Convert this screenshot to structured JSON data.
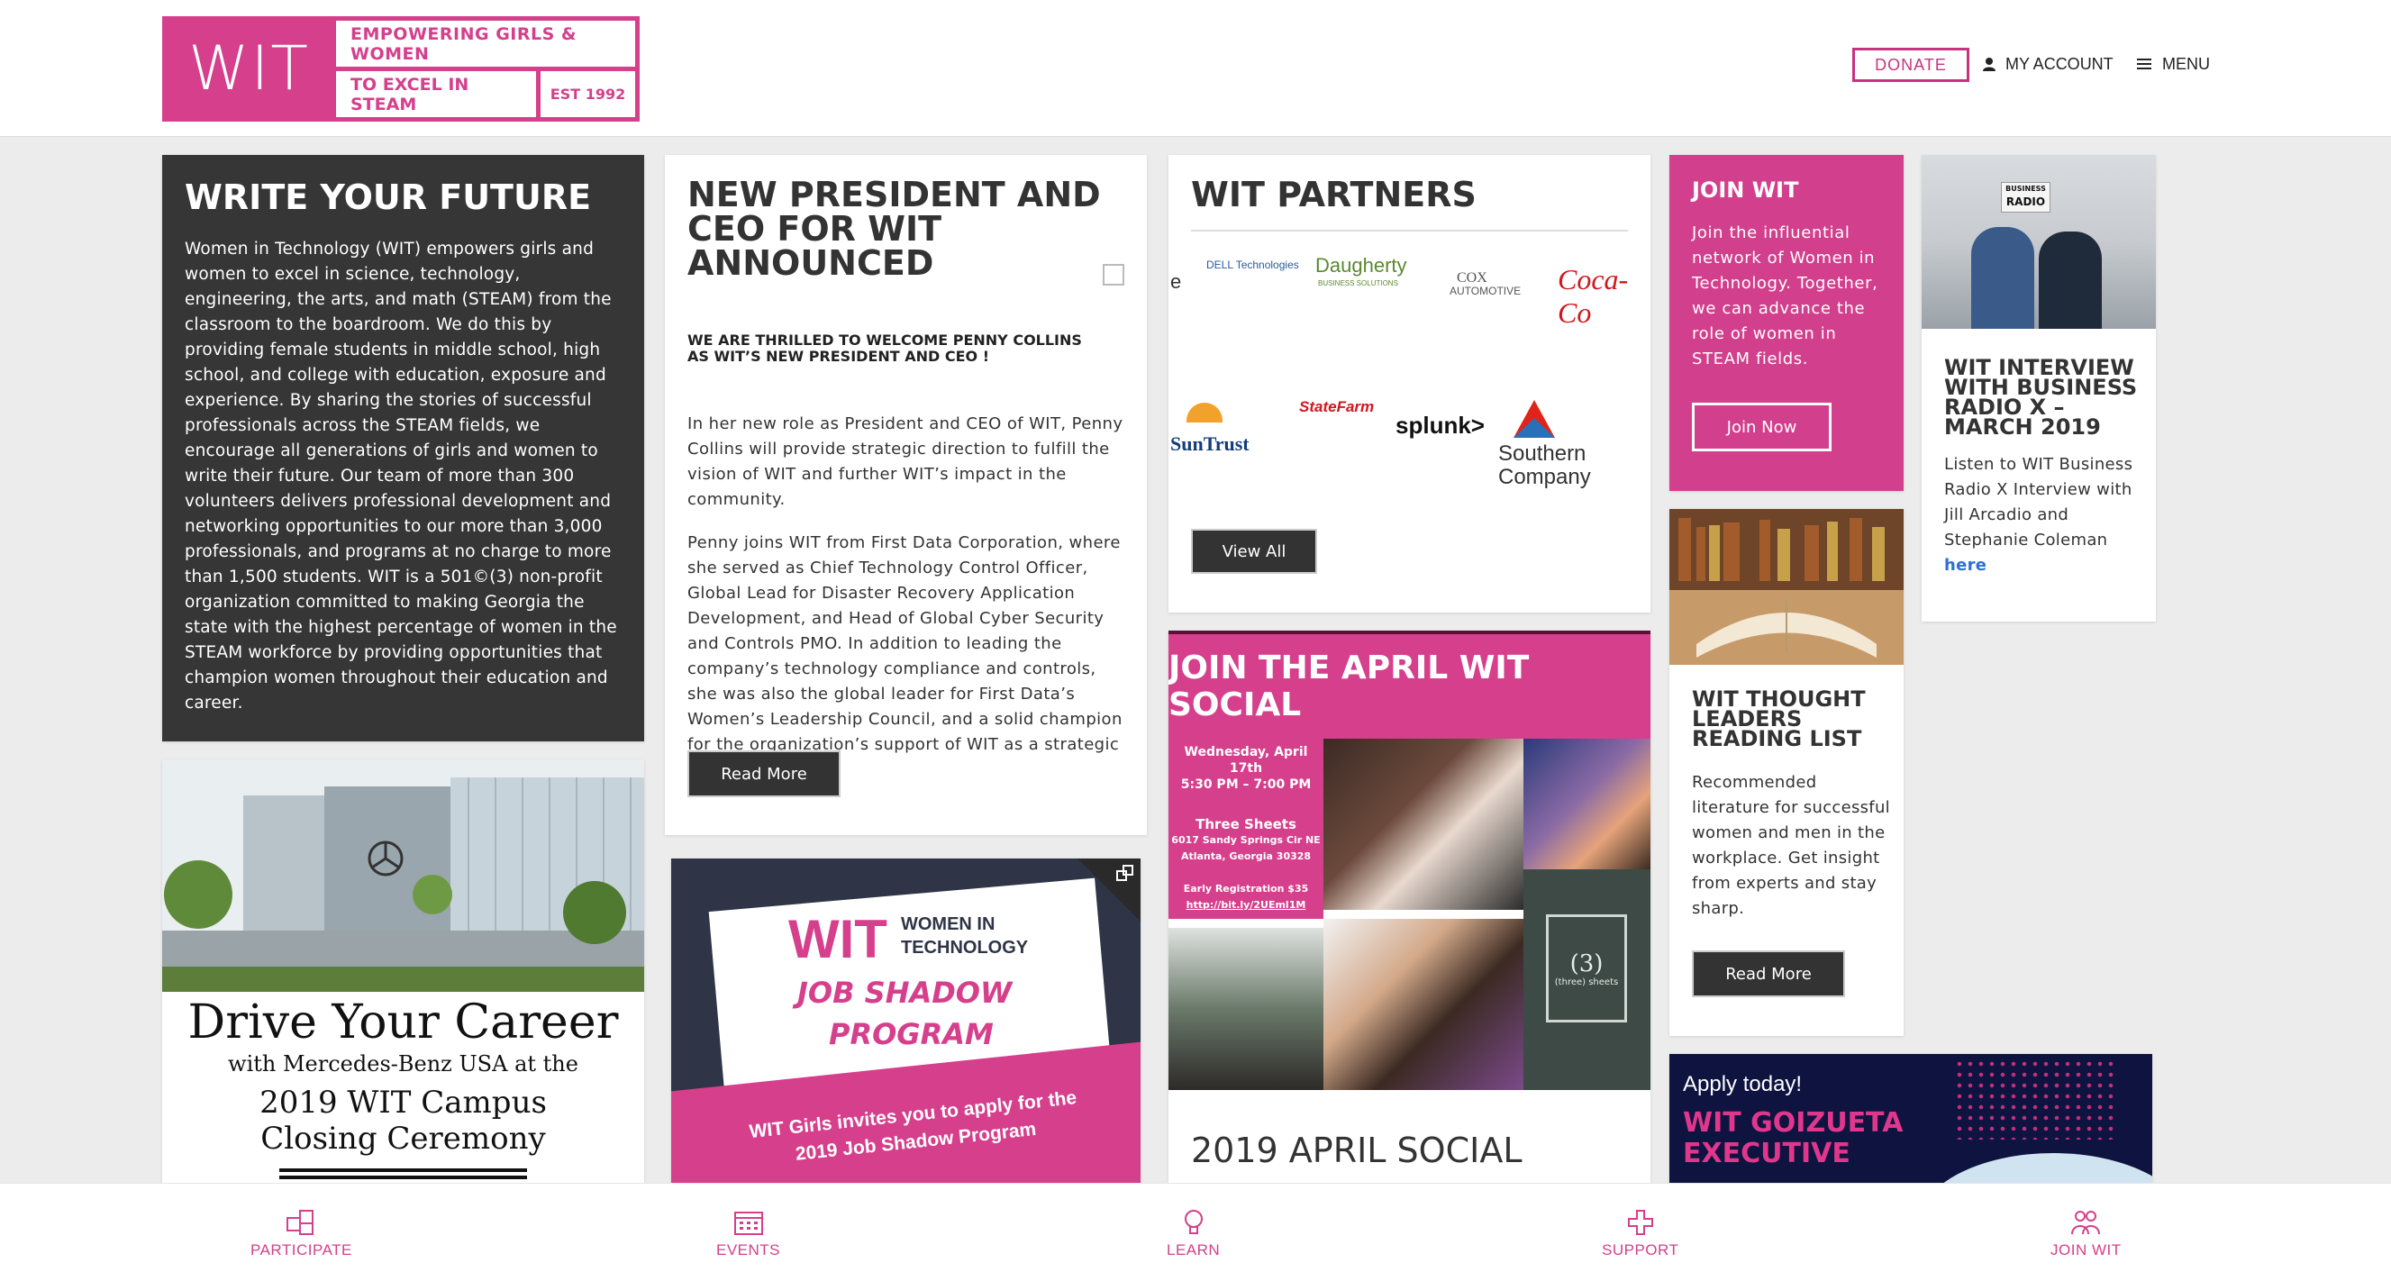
{
  "header": {
    "logo_mark": "WIT",
    "logo_line1": "EMPOWERING GIRLS & WOMEN",
    "logo_line2": "TO EXCEL IN STEAM",
    "logo_est": "EST 1992",
    "donate": "DONATE",
    "account": "MY ACCOUNT",
    "menu": "MENU"
  },
  "write_future": {
    "title": "WRITE YOUR FUTURE",
    "body": "Women in Technology (WIT) empowers girls and women to excel in science, technology, engineering, the arts, and math (STEAM) from the classroom to the boardroom. We do this by providing female students in middle school, high school, and college with education, exposure and experience. By sharing the stories of successful professionals across the STEAM fields, we encourage all generations of girls and women to write their future. Our team of more than 300 volunteers delivers professional development and networking opportunities to our more than 3,000 professionals, and programs at no charge to more than 1,500 students. WIT is a 501©(3) non-profit organization committed to making Georgia the state with the highest percentage of women in the STEAM workforce by providing opportunities that champion women throughout their education and career."
  },
  "drive": {
    "title": "Drive Your Career",
    "subtitle": "with Mercedes-Benz USA at the",
    "line1": "2019 WIT Campus",
    "line2": "Closing Ceremony"
  },
  "president": {
    "title": "NEW PRESIDENT AND CEO FOR WIT ANNOUNCED",
    "subtitle": "WE ARE THRILLED TO WELCOME PENNY COLLINS AS WIT’S NEW PRESIDENT AND CEO !",
    "para1": "In her new role as President and CEO of WIT, Penny Collins will provide strategic direction to fulfill the vision of WIT and further WIT’s impact in the community.",
    "para2": "Penny joins WIT from First Data Corporation, where she served as Chief Technology Control Officer, Global Lead for Disaster Recovery Application Development, and Head of Global Cyber Security and Controls PMO. In addition to leading the company’s technology compliance and controls, she was also the global leader for First Data’s Women’s Leadership Council, and a solid champion for the organization’s support of WIT as a strategic partner.",
    "button": "Read More"
  },
  "job_shadow": {
    "wit": "WIT",
    "women": "WOMEN IN",
    "tech": "TECHNOLOGY",
    "line1": "JOB SHADOW",
    "line2": "PROGRAM",
    "invite1": "WIT Girls invites you to apply for the",
    "invite2": "2019 Job Shadow Program"
  },
  "partners": {
    "title": "WIT PARTNERS",
    "logos": {
      "edge": "e",
      "dell": "DELL Technologies",
      "daugherty": "Daugherty",
      "daugherty_sub": "BUSINESS SOLUTIONS",
      "cox1": "COX",
      "cox2": "AUTOMOTIVE",
      "coke": "Coca-Co",
      "suntrust": "SunTrust",
      "statefarm": "StateFarm",
      "splunk": "splunk>",
      "southern1": "Southern",
      "southern2": "Company"
    },
    "button": "View All"
  },
  "social": {
    "banner": "JOIN THE APRIL WIT SOCIAL",
    "date": "Wednesday, April 17th",
    "time": "5:30 PM – 7:00 PM",
    "venue": "Three Sheets",
    "address1": "6017 Sandy Springs Cir NE",
    "address2": "Atlanta, Georgia 30328",
    "early": "Early Registration $35",
    "link": "http://bit.ly/2UEml1M",
    "sign": "(3)",
    "sign_sub": "(three) sheets",
    "title": "2019 APRIL SOCIAL"
  },
  "join": {
    "title": "JOIN WIT",
    "body": "Join the influential network of Women in Technology. Together, we can advance the role of women in STEAM fields.",
    "button": "Join Now"
  },
  "thought": {
    "title": "WIT THOUGHT LEADERS READING LIST",
    "body": "Recommended literature for successful women and men in the workplace. Get insight from experts and stay sharp.",
    "button": "Read More"
  },
  "goizueta": {
    "apply": "Apply today!",
    "title": "WIT GOIZUETA EXECUTIVE"
  },
  "radio": {
    "sign1": "BUSINESS",
    "sign2": "RADIO",
    "title": "WIT INTERVIEW WITH BUSINESS RADIO X – MARCH 2019",
    "body": "Listen to WIT Business Radio X Interview with Jill Arcadio and Stephanie Coleman",
    "link": "here"
  },
  "bottom_nav": {
    "participate": "PARTICIPATE",
    "events": "EVENTS",
    "learn": "LEARN",
    "support": "SUPPORT",
    "join": "JOIN WIT"
  },
  "colors": {
    "brand_pink": "#d53f8c",
    "dark_gray": "#363636",
    "navy": "#0e1340"
  }
}
